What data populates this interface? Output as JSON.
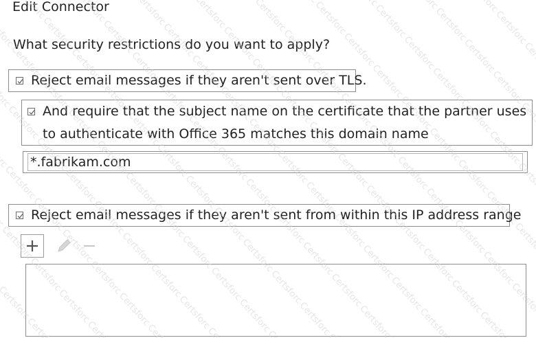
{
  "page": {
    "title": "Edit Connector",
    "question": "What security restrictions do you want to apply?"
  },
  "options": {
    "tls": {
      "label": "Reject email messages if they aren't sent over TLS.",
      "checked": true
    },
    "subject_name": {
      "label": "And require that the subject name on the certificate that the partner uses to authenticate with Office 365 matches this domain name",
      "checked": true
    },
    "domain": {
      "value": "*.fabrikam.com"
    },
    "ip_range": {
      "label": "Reject email messages if they aren't sent from within this IP address range",
      "checked": true
    }
  },
  "toolbar": {
    "add_icon": "plus-icon",
    "edit_icon": "pencil-icon",
    "remove_icon": "minus-icon"
  },
  "ip_list": {
    "items": []
  },
  "watermark": {
    "text": "Certsforce",
    "color": "#cfcfcf"
  },
  "colors": {
    "text": "#222222",
    "border": "#8c8c8c",
    "disabled": "#c8c8c8"
  }
}
